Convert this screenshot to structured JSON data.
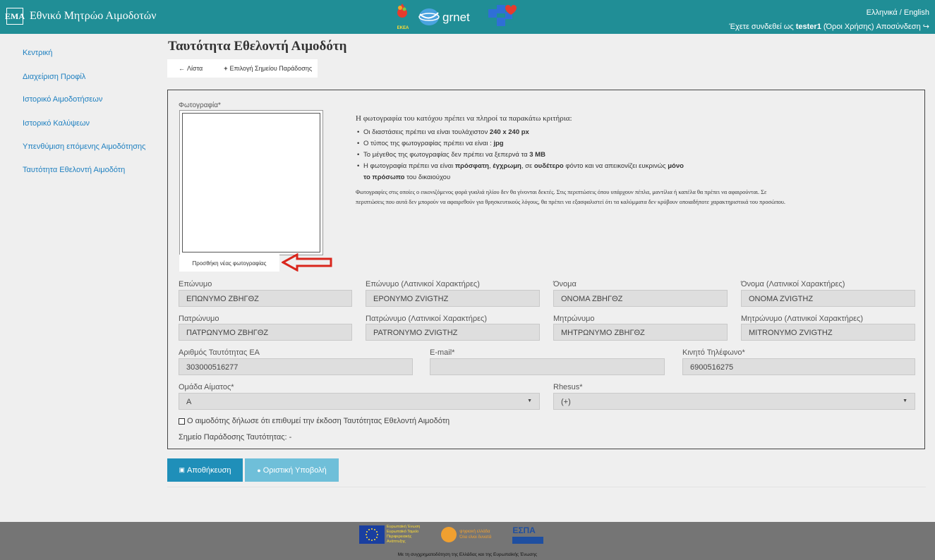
{
  "header": {
    "logo_text": "ΕΜΑ",
    "app_title": "Εθνικό Μητρώο Αιμοδοτών",
    "ekea_label": "ΕΚΕΑ",
    "grnet_label": "grnet",
    "language_switch": "Ελληνικά / English",
    "connected_prefix": "Έχετε συνδεθεί ως",
    "username": "tester1",
    "terms_link": "(Όροι Χρήσης)",
    "logout_link": "Αποσύνδεση"
  },
  "sidebar": {
    "items": [
      {
        "label": "Κεντρική"
      },
      {
        "label": "Διαχείριση Προφίλ"
      },
      {
        "label": "Ιστορικό Αιμοδοτήσεων"
      },
      {
        "label": "Ιστορικό Καλύψεων"
      },
      {
        "label": "Υπενθύμιση επόμενης Αιμοδότησης"
      },
      {
        "label": "Ταυτότητα Εθελοντή Αιμοδότη"
      }
    ]
  },
  "page": {
    "title": "Ταυτότητα Εθελοντή Αιμοδότη",
    "toolbar": {
      "list_label": "Λίστα",
      "add_point_label": "Επιλογή Σημείου Παράδοσης"
    }
  },
  "photo": {
    "label": "Φωτογραφία*",
    "add_button": "Προσθήκη νέας φωτογραφίας",
    "criteria_title": "Η φωτογραφία του κατόχου πρέπει να πληροί τα παρακάτω κριτήρια:",
    "criteria": [
      {
        "pre": "Οι διαστάσεις πρέπει να είναι τουλάχιστον ",
        "b1": "240 x 240 px"
      },
      {
        "pre": "Ο τύπος της φωτογραφίας πρέπει να είναι : ",
        "b1": "jpg"
      },
      {
        "pre": "Το μέγεθος της φωτογραφίας δεν πρέπει να ξεπερνά τα ",
        "b1": "3 MB"
      },
      {
        "pre": "Η φωτογραφία πρέπει να είναι ",
        "b1": "πρόσφατη",
        "mid1": ", ",
        "b2": "έγχρωμη",
        "mid2": ", σε ",
        "b3": "ουδέτερο",
        "mid3": " φόντο και να απεικονίζει ευκρινώς ",
        "b4": "μόνο το πρόσωπο",
        "post": " του δικαιούχου"
      }
    ],
    "note": "Φωτογραφίες στις οποίες ο εικονιζόμενος φορά γυαλιά ηλίου δεν θα γίνονται δεκτές. Στις περιπτώσεις όπου υπάρχουν πέπλα, μαντίλια ή καπέλα θα πρέπει να αφαιρούνται. Σε περιπτώσεις που αυτά δεν μπορούν να αφαιρεθούν για θρησκευτικούς λόγους, θα πρέπει να εξασφαλιστεί ότι τα καλύμματα δεν κρύβουν οποιαδήποτε χαρακτηριστικά του προσώπου."
  },
  "form": {
    "surname": {
      "label": "Επώνυμο",
      "value": "ΕΠΩΝΥΜΟ ΖΒΗΓΘΖ"
    },
    "surname_latin": {
      "label": "Επώνυμο (Λατινικοί Χαρακτήρες)",
      "value": "EPONYMO ZVIGTHZ"
    },
    "name": {
      "label": "Όνομα",
      "value": "ΟΝΟΜΑ ΖΒΗΓΘΖ"
    },
    "name_latin": {
      "label": "Όνομα (Λατινικοί Χαρακτήρες)",
      "value": "ONOMA ZVIGTHZ"
    },
    "father": {
      "label": "Πατρώνυμο",
      "value": "ΠΑΤΡΩΝΥΜΟ ΖΒΗΓΘΖ"
    },
    "father_latin": {
      "label": "Πατρώνυμο (Λατινικοί Χαρακτήρες)",
      "value": "PATRONYMO ZVIGTHZ"
    },
    "mother": {
      "label": "Μητρώνυμο",
      "value": "ΜΗΤΡΩΝΥΜΟ ΖΒΗΓΘΖ"
    },
    "mother_latin": {
      "label": "Μητρώνυμο (Λατινικοί Χαρακτήρες)",
      "value": "MITRONYMO ZVIGTHZ"
    },
    "id_number": {
      "label": "Αριθμός Ταυτότητας ΕΑ",
      "value": "303000516277"
    },
    "email": {
      "label": "E-mail*",
      "value": ""
    },
    "mobile": {
      "label": "Κινητό Τηλέφωνο*",
      "value": "6900516275"
    },
    "blood_group": {
      "label": "Ομάδα Αίματος*",
      "value": "A"
    },
    "rhesus": {
      "label": "Rhesus*",
      "value": "(+)"
    },
    "consent_label": "Ο αιμοδότης δήλωσε ότι επιθυμεί την έκδοση Ταυτότητας Εθελοντή Αιμοδότη",
    "delivery_label": "Σημείο Παράδοσης Ταυτότητας: -"
  },
  "actions": {
    "save_label": "Αποθήκευση",
    "submit_label": "Οριστική Υποβολή"
  },
  "footer": {
    "eu_text": [
      "Ευρωπαϊκή Ένωση",
      "Ευρωπαϊκό Ταμείο",
      "Περιφερειακής",
      "Ανάπτυξης"
    ],
    "psif_text": [
      "ψηφιακή ελλάδα",
      "Όλα είναι δυνατά"
    ],
    "espa_label": "ΕΣΠΑ",
    "caption": "Με τη συγχρηματοδότηση της Ελλάδας και της Ευρωπαϊκής Ένωσης"
  },
  "colors": {
    "header_bg": "#208e96",
    "link": "#1f80c0",
    "save_btn": "#1f8fb9",
    "submit_btn": "#6fbfd9",
    "arrow_red": "#d9261c"
  }
}
